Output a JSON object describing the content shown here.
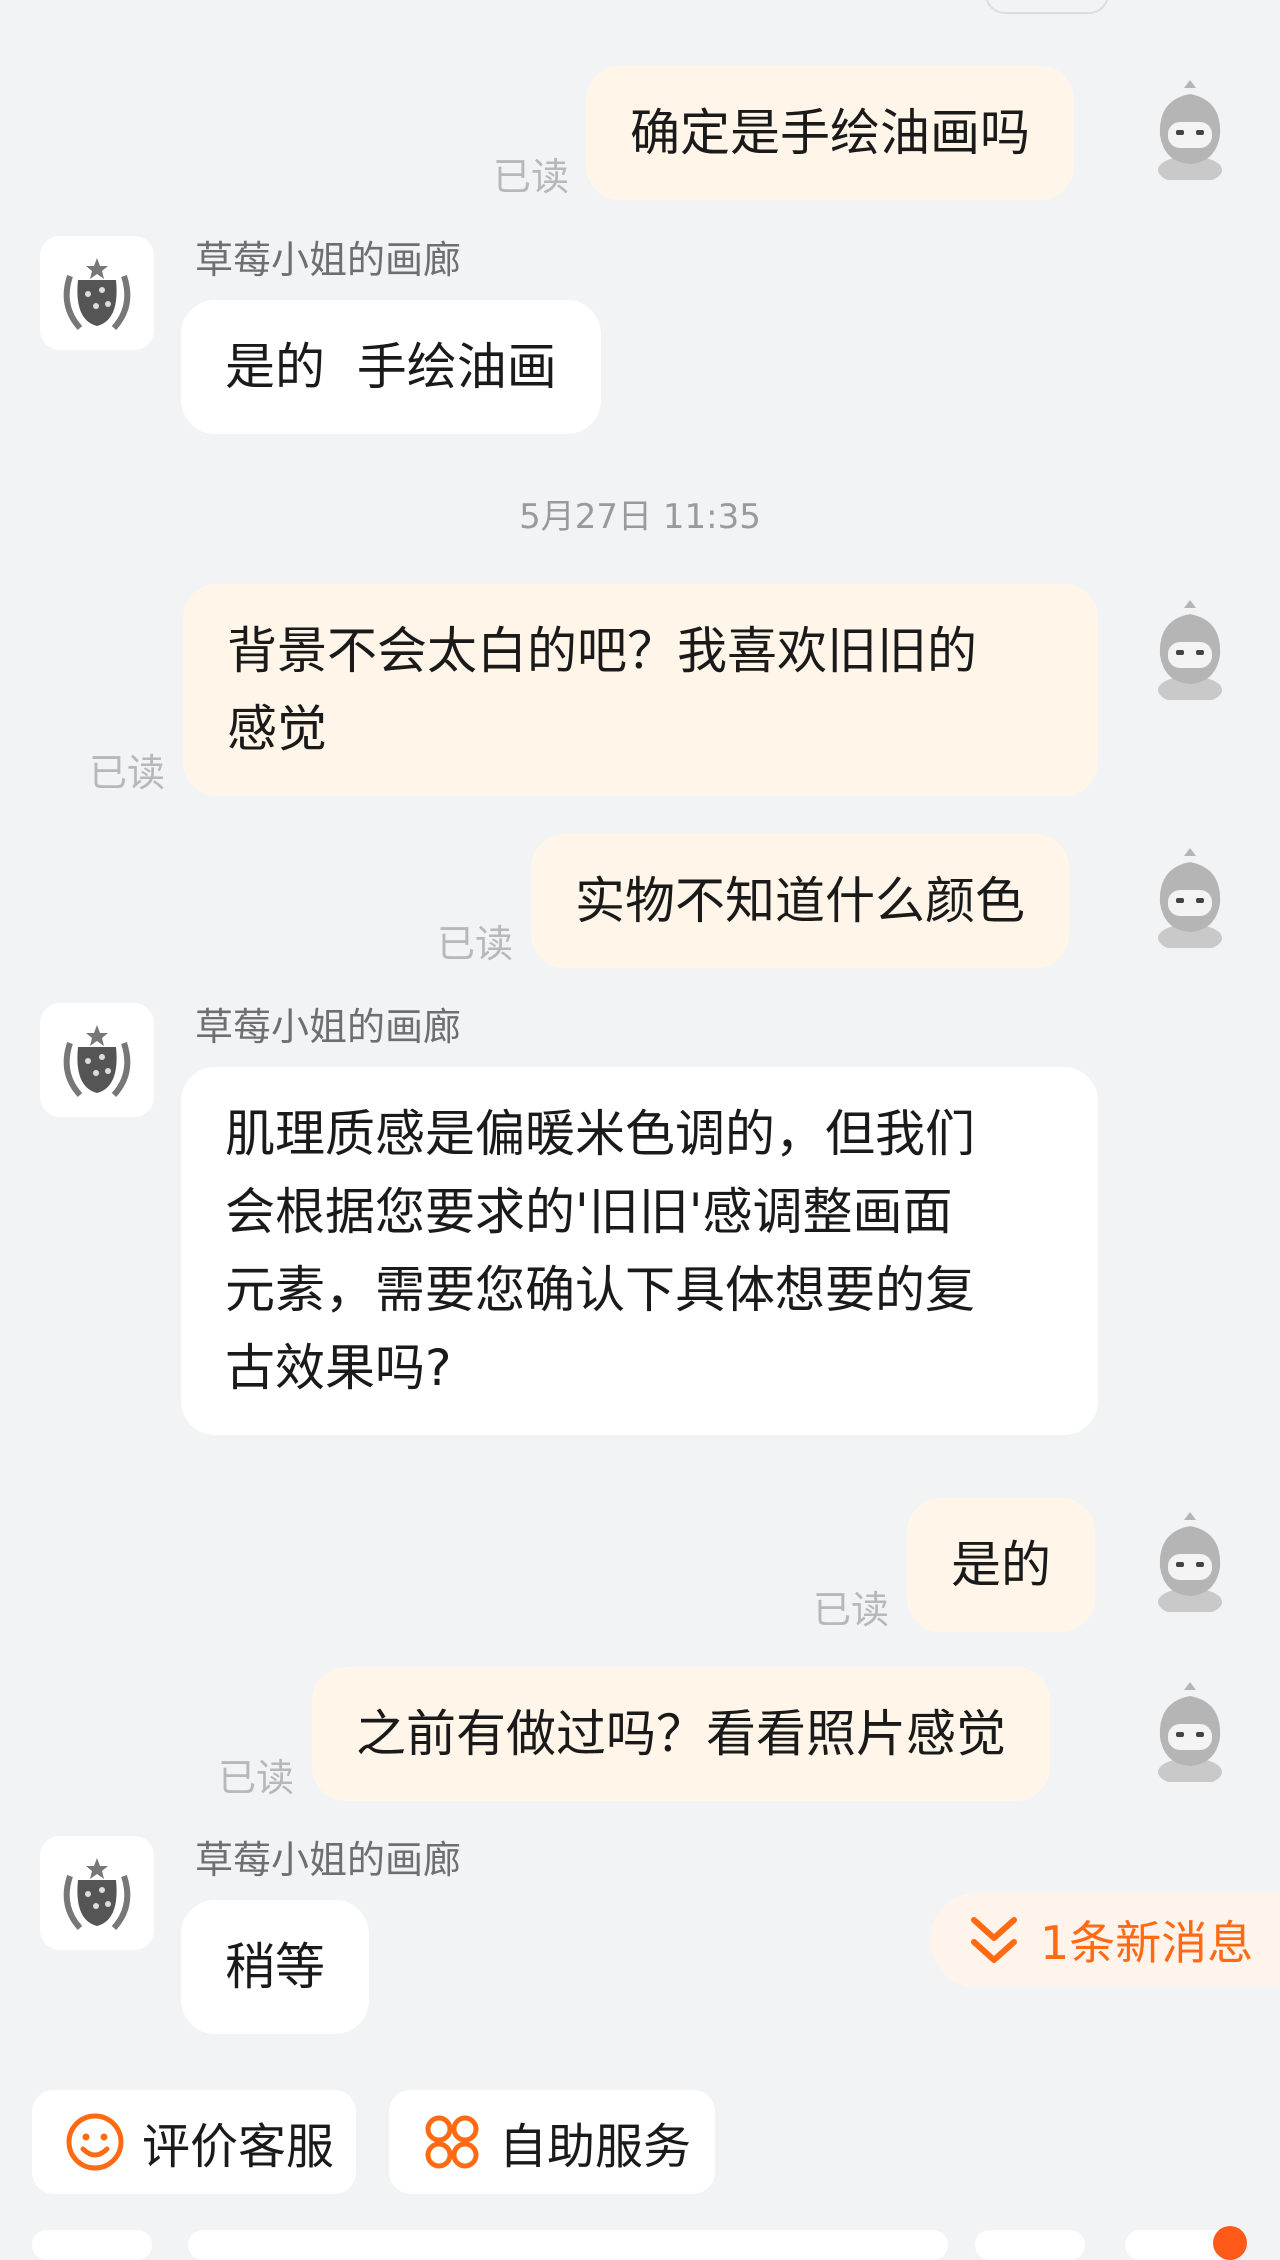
{
  "colors": {
    "background": "#f2f3f5",
    "my_bubble": "#fff6e9",
    "shop_bubble": "#ffffff",
    "accent": "#ff6a13",
    "read_text": "#b8b8b8"
  },
  "messages": [
    {
      "side": "me",
      "text": "确定是手绘油画吗",
      "status": "已读"
    },
    {
      "side": "shop",
      "sender": "草莓小姐的画廊",
      "text": "是的  手绘油画"
    },
    {
      "side": "time",
      "text": "5月27日 11:35"
    },
    {
      "side": "me",
      "text": "背景不会太白的吧？我喜欢旧旧的\n感觉",
      "status": "已读"
    },
    {
      "side": "me",
      "text": "实物不知道什么颜色",
      "status": "已读"
    },
    {
      "side": "shop",
      "sender": "草莓小姐的画廊",
      "text": "肌理质感是偏暖米色调的，但我们\n会根据您要求的'旧旧'感调整画面\n元素，需要您确认下具体想要的复\n古效果吗?"
    },
    {
      "side": "me",
      "text": "是的",
      "status": "已读"
    },
    {
      "side": "me",
      "text": "之前有做过吗？看看照片感觉",
      "status": "已读"
    },
    {
      "side": "shop",
      "sender": "草莓小姐的画廊",
      "text": "稍等"
    }
  ],
  "new_message_pill": {
    "label": "1条新消息",
    "icon": "double-chevron-down-icon"
  },
  "quick_actions": [
    {
      "label": "评价客服",
      "icon": "smiley-face-icon"
    },
    {
      "label": "自助服务",
      "icon": "four-circles-icon"
    }
  ]
}
